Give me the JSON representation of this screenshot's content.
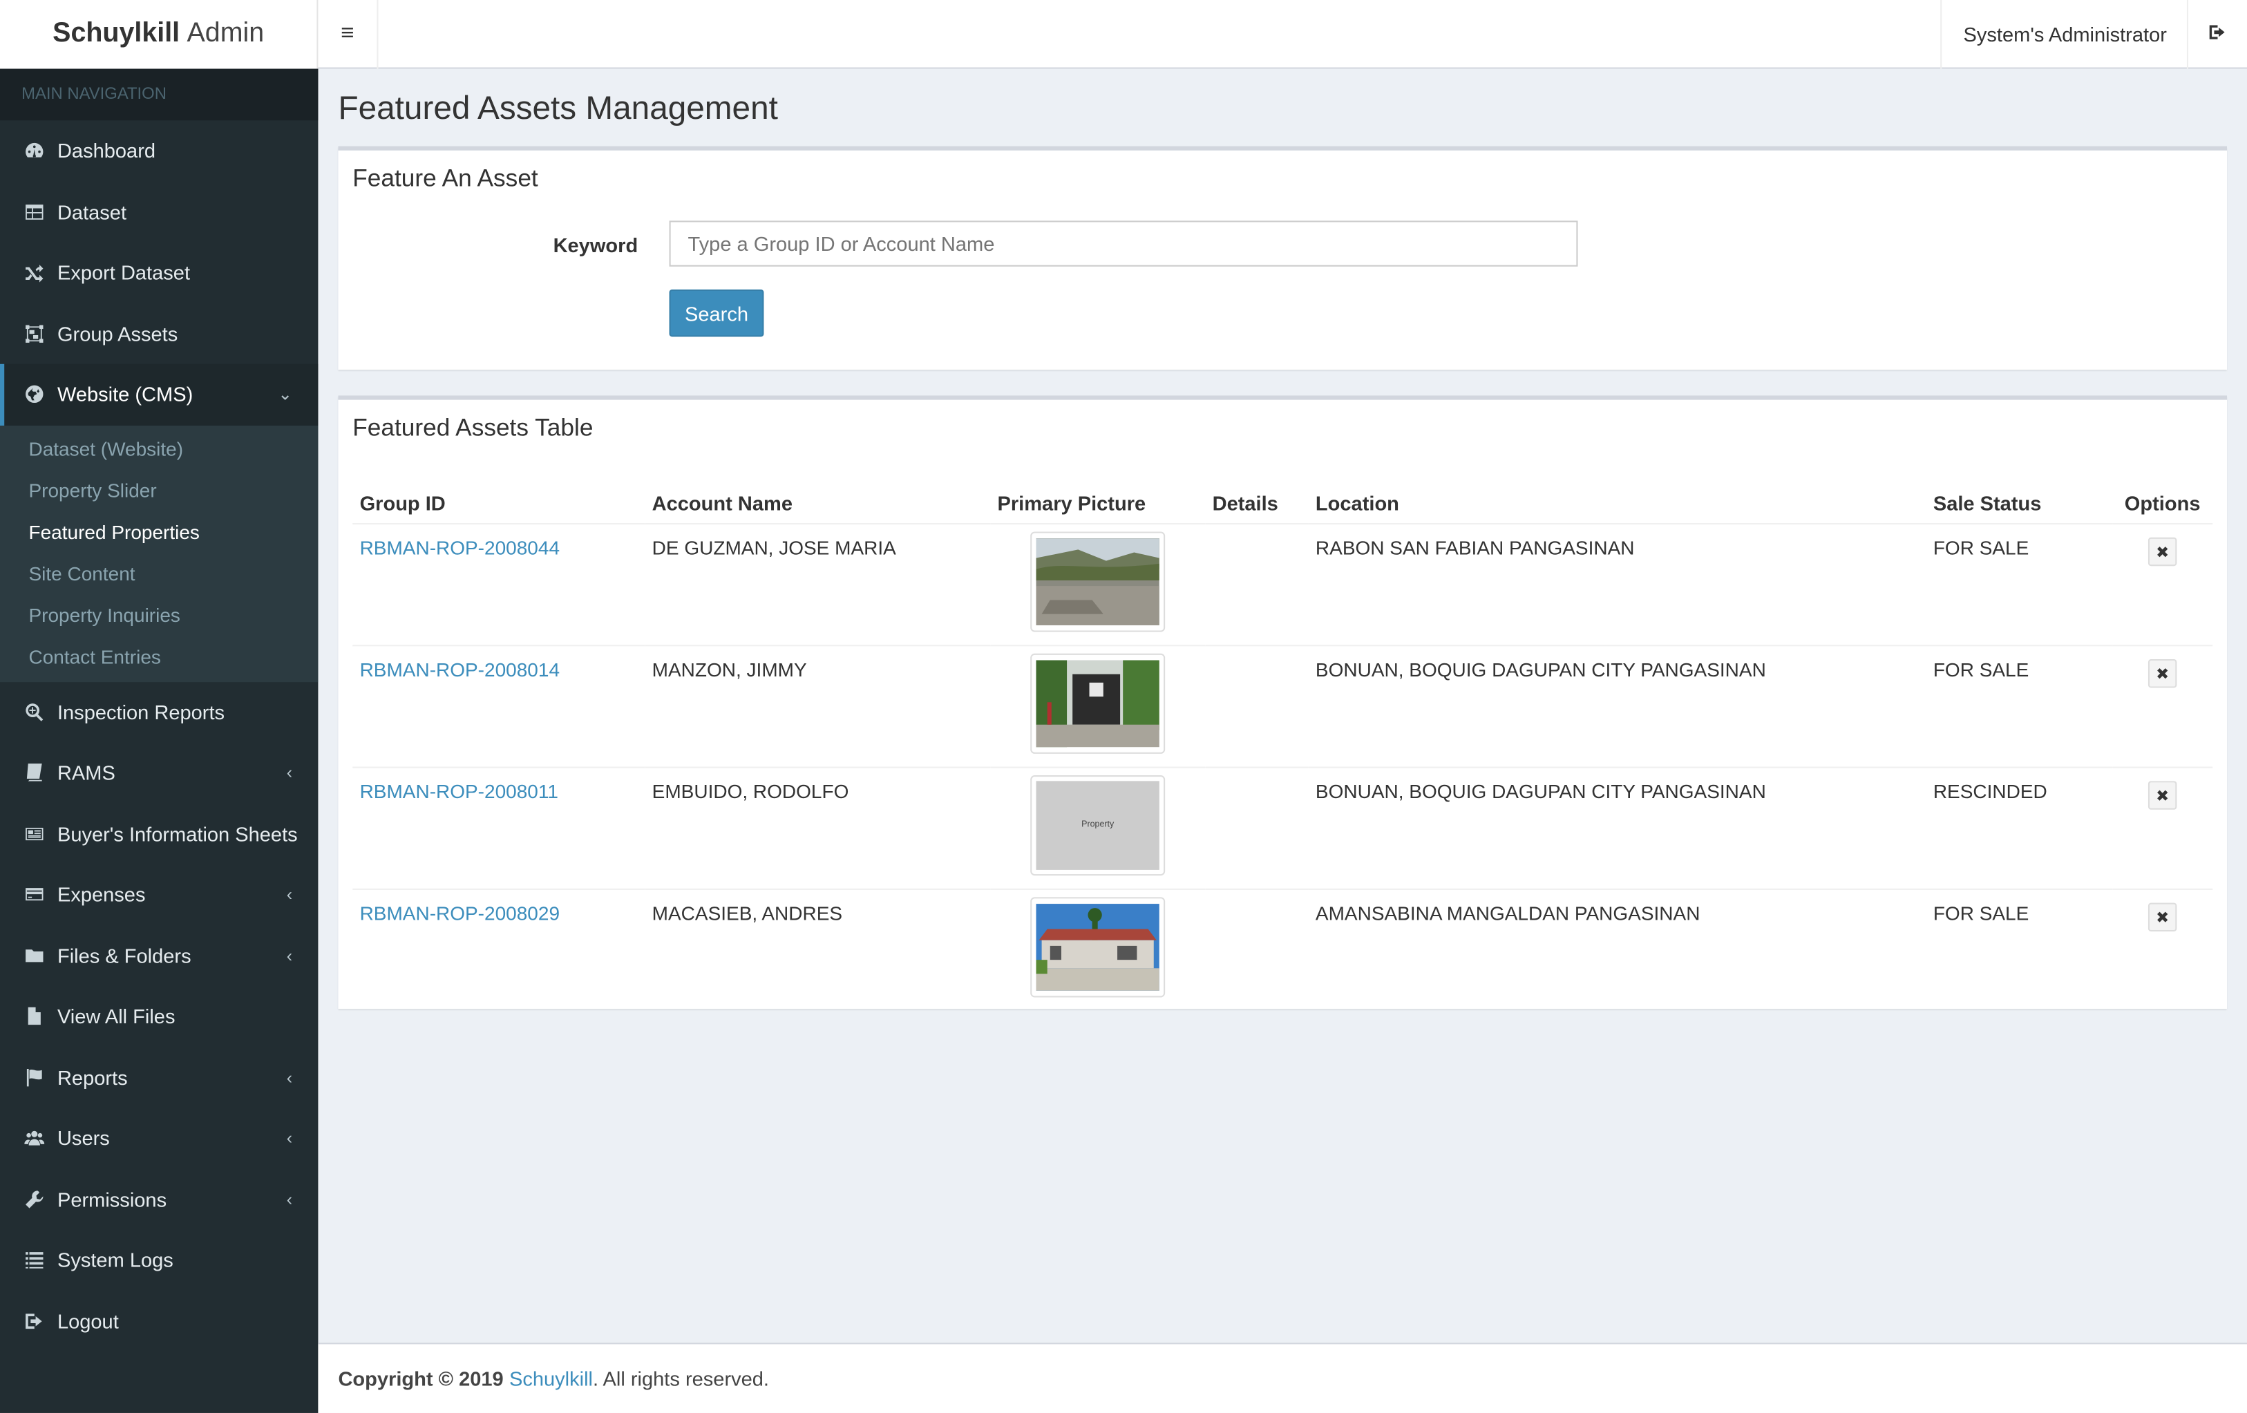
{
  "app": {
    "brand_bold": "Schuylkill",
    "brand_light": "Admin",
    "user_name": "System's Administrator"
  },
  "sidebar": {
    "header": "MAIN NAVIGATION",
    "items": [
      {
        "label": "Dashboard",
        "icon": "dashboard-icon"
      },
      {
        "label": "Dataset",
        "icon": "table-icon"
      },
      {
        "label": "Export Dataset",
        "icon": "shuffle-icon"
      },
      {
        "label": "Group Assets",
        "icon": "object-group-icon"
      },
      {
        "label": "Website (CMS)",
        "icon": "globe-icon",
        "active": true
      },
      {
        "label": "Inspection Reports",
        "icon": "search-plus-icon"
      },
      {
        "label": "RAMS",
        "icon": "book-icon"
      },
      {
        "label": "Buyer's Information Sheets",
        "icon": "newspaper-icon"
      },
      {
        "label": "Expenses",
        "icon": "credit-card-icon"
      },
      {
        "label": "Files & Folders",
        "icon": "folder-icon"
      },
      {
        "label": "View All Files",
        "icon": "file-icon"
      },
      {
        "label": "Reports",
        "icon": "flag-icon"
      },
      {
        "label": "Users",
        "icon": "users-icon"
      },
      {
        "label": "Permissions",
        "icon": "wrench-icon"
      },
      {
        "label": "System Logs",
        "icon": "list-icon"
      },
      {
        "label": "Logout",
        "icon": "sign-out-icon"
      }
    ],
    "submenu": [
      "Dataset (Website)",
      "Property Slider",
      "Featured Properties",
      "Site Content",
      "Property Inquiries",
      "Contact Entries"
    ]
  },
  "page": {
    "title": "Featured Assets Management"
  },
  "feature_box": {
    "title": "Feature An Asset",
    "keyword_label": "Keyword",
    "keyword_placeholder": "Type a Group ID or Account Name",
    "keyword_value": "",
    "search_label": "Search"
  },
  "table_box": {
    "title": "Featured Assets Table",
    "columns": [
      "Group ID",
      "Account Name",
      "Primary Picture",
      "Details",
      "Location",
      "Sale Status",
      "Options"
    ],
    "rows": [
      {
        "group_id": "RBMAN-ROP-2008044",
        "account": "DE GUZMAN, JOSE MARIA",
        "picture": "land-photo",
        "details": "",
        "location": "RABON SAN FABIAN PANGASINAN",
        "status": "FOR SALE"
      },
      {
        "group_id": "RBMAN-ROP-2008014",
        "account": "MANZON, JIMMY",
        "picture": "gate-photo",
        "details": "",
        "location": "BONUAN, BOQUIG DAGUPAN CITY PANGASINAN",
        "status": "FOR SALE"
      },
      {
        "group_id": "RBMAN-ROP-2008011",
        "account": "EMBUIDO, RODOLFO",
        "picture": "placeholder",
        "picture_text": "Property",
        "details": "",
        "location": "BONUAN, BOQUIG DAGUPAN CITY PANGASINAN",
        "status": "RESCINDED"
      },
      {
        "group_id": "RBMAN-ROP-2008029",
        "account": "MACASIEB, ANDRES",
        "picture": "house-photo",
        "details": "",
        "location": "AMANSABINA MANGALDAN PANGASINAN",
        "status": "FOR SALE"
      }
    ]
  },
  "footer": {
    "prefix": "Copyright © 2019",
    "link": "Schuylkill",
    "suffix": ". All rights reserved."
  },
  "colors": {
    "sidebar": "#222d32",
    "accent": "#3c8dbc",
    "background": "#ecf0f5"
  }
}
